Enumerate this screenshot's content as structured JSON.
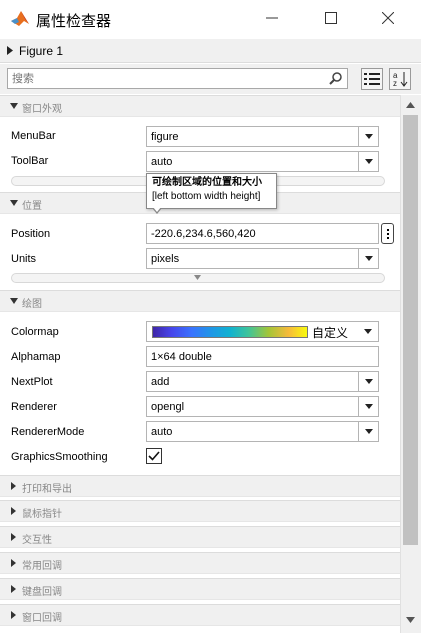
{
  "window": {
    "title": "属性检查器",
    "icon": "matlab-logo-icon"
  },
  "figure_header": {
    "label": "Figure 1"
  },
  "search": {
    "placeholder": "搜索",
    "value": ""
  },
  "toolbar": {
    "categorize_icon": "list-icon",
    "sort_icon": "sort-az-icon",
    "sort_label_a": "a",
    "sort_label_z": "z"
  },
  "sections": {
    "window_appearance": "窗口外观",
    "position": "位置",
    "plotting": "绘图",
    "print_export": "打印和导出",
    "mouse_pointer": "鼠标指针",
    "interactivity": "交互性",
    "common_callbacks": "常用回调",
    "keyboard_callbacks": "键盘回调",
    "window_callbacks": "窗口回调"
  },
  "props": {
    "menubar": {
      "label": "MenuBar",
      "value": "figure"
    },
    "toolbar": {
      "label": "ToolBar",
      "value": "auto"
    },
    "position": {
      "label": "Position",
      "value": "-220.6,234.6,560,420"
    },
    "units": {
      "label": "Units",
      "value": "pixels"
    },
    "colormap": {
      "label": "Colormap",
      "value": "自定义"
    },
    "alphamap": {
      "label": "Alphamap",
      "value": "1×64 double"
    },
    "nextplot": {
      "label": "NextPlot",
      "value": "add"
    },
    "renderer": {
      "label": "Renderer",
      "value": "opengl"
    },
    "renderermode": {
      "label": "RendererMode",
      "value": "auto"
    },
    "graphicssmoothing": {
      "label": "GraphicsSmoothing",
      "checked": true
    }
  },
  "tooltip": {
    "title": "可绘制区域的位置和大小",
    "subtitle": "[left bottom width height]"
  },
  "colors": {
    "section_bg": "#f0f0f0",
    "field_border": "#b4b4b4",
    "scroll_thumb": "#c1c1c1"
  }
}
